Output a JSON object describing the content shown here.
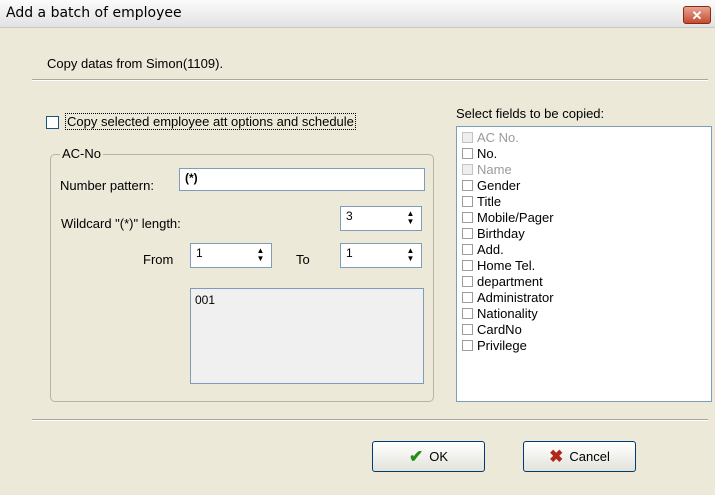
{
  "window": {
    "title": "Add a batch of employee",
    "close_glyph": "✕"
  },
  "header_text": "Copy datas from Simon(1109).",
  "copy_options_checkbox": {
    "label": "Copy selected employee att options and schedule",
    "checked": false
  },
  "ac_no_group": {
    "legend": "AC-No",
    "number_pattern_label": "Number pattern:",
    "number_pattern_value": "(*)",
    "wildcard_length_label": "Wildcard \"(*)\" length:",
    "wildcard_length_value": "3",
    "from_label": "From",
    "from_value": "1",
    "to_label": "To",
    "to_value": "1",
    "preview": "001"
  },
  "fields_panel": {
    "label": "Select fields to be copied:",
    "items": [
      {
        "label": "AC No.",
        "disabled": true
      },
      {
        "label": "No.",
        "disabled": false
      },
      {
        "label": "Name",
        "disabled": true
      },
      {
        "label": "Gender",
        "disabled": false
      },
      {
        "label": "Title",
        "disabled": false
      },
      {
        "label": "Mobile/Pager",
        "disabled": false
      },
      {
        "label": "Birthday",
        "disabled": false
      },
      {
        "label": "Add.",
        "disabled": false
      },
      {
        "label": "Home Tel.",
        "disabled": false
      },
      {
        "label": "department",
        "disabled": false
      },
      {
        "label": "Administrator",
        "disabled": false
      },
      {
        "label": "Nationality",
        "disabled": false
      },
      {
        "label": "CardNo",
        "disabled": false
      },
      {
        "label": "Privilege",
        "disabled": false
      }
    ]
  },
  "buttons": {
    "ok_label": "OK",
    "cancel_label": "Cancel",
    "ok_icon": "check-icon",
    "cancel_icon": "x-icon"
  },
  "colors": {
    "ok_icon": "#2a8a1a",
    "cancel_icon": "#b0281a"
  }
}
